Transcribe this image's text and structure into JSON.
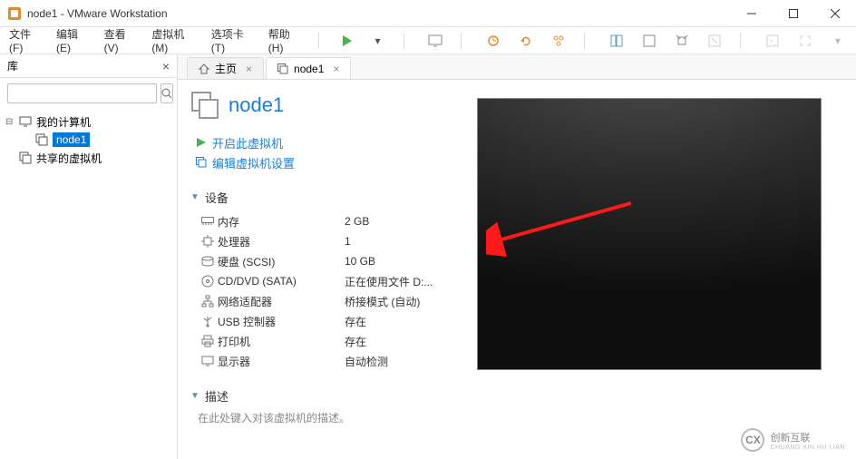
{
  "window": {
    "title": "node1 - VMware Workstation"
  },
  "menus": {
    "file": "文件(F)",
    "edit": "编辑(E)",
    "view": "查看(V)",
    "vm": "虚拟机(M)",
    "tabs": "选项卡(T)",
    "help": "帮助(H)"
  },
  "sidebar": {
    "title": "库",
    "search_placeholder": "",
    "tree": {
      "root": "我的计算机",
      "node1": "node1",
      "shared": "共享的虚拟机"
    }
  },
  "tabs": {
    "home": "主页",
    "node1": "node1"
  },
  "vm": {
    "name": "node1",
    "power_on": "开启此虚拟机",
    "edit_settings": "编辑虚拟机设置",
    "devices_section": "设备",
    "description_section": "描述",
    "description_placeholder": "在此处键入对该虚拟机的描述。"
  },
  "devices": {
    "memory": {
      "label": "内存",
      "value": "2 GB"
    },
    "cpu": {
      "label": "处理器",
      "value": "1"
    },
    "disk": {
      "label": "硬盘 (SCSI)",
      "value": "10 GB"
    },
    "cd": {
      "label": "CD/DVD (SATA)",
      "value": "正在使用文件 D:..."
    },
    "net": {
      "label": "网络适配器",
      "value": "桥接模式 (自动)"
    },
    "usb": {
      "label": "USB 控制器",
      "value": "存在"
    },
    "printer": {
      "label": "打印机",
      "value": "存在"
    },
    "display": {
      "label": "显示器",
      "value": "自动检测"
    }
  },
  "watermark": {
    "brand": "创新互联",
    "sub": "CHUANG XIN HU LIAN"
  }
}
